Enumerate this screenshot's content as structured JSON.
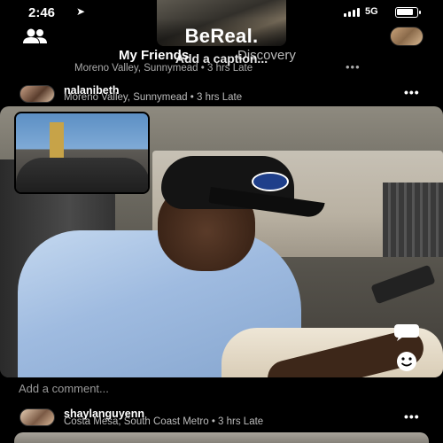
{
  "status_bar": {
    "time": "2:46",
    "location_icon": "location-arrow-icon",
    "network": "5G",
    "battery_level": 0.85
  },
  "header": {
    "title": "BeReal.",
    "friends_icon": "friends-icon",
    "tabs": [
      {
        "label": "My Friends",
        "active": true
      },
      {
        "label": "Discovery",
        "active": false
      }
    ],
    "add_caption": "Add a caption...",
    "own_location": "Moreno Valley, Sunnymead • 3 hrs Late",
    "own_more": "•••"
  },
  "posts": [
    {
      "username": "nalanibeth",
      "meta": "Moreno Valley, Sunnymead • 3 hrs Late",
      "more": "•••",
      "comment_placeholder": "Add a comment..."
    },
    {
      "username": "shaylanguyenn",
      "meta": "Costa Mesa, South Coast Metro • 3 hrs Late",
      "more": "•••"
    }
  ],
  "colors": {
    "background": "#000000",
    "text": "#ffffff",
    "muted_text": "#aaaaaa"
  }
}
